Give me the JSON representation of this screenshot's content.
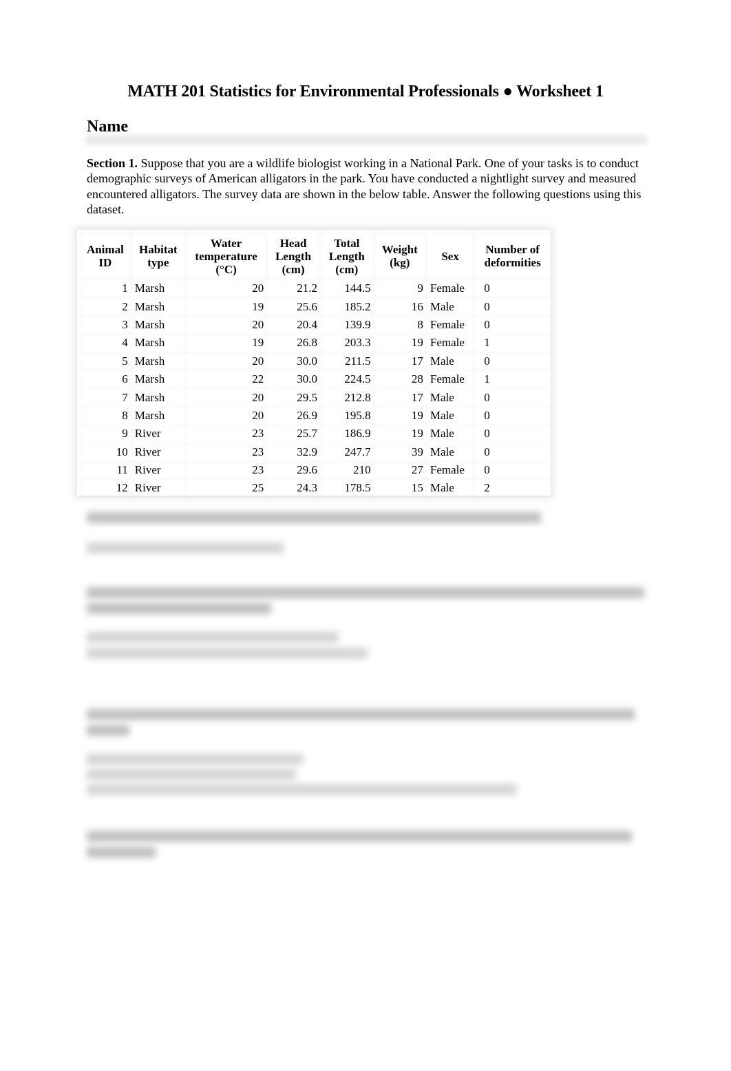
{
  "document": {
    "title": "MATH 201 Statistics for Environmental Professionals ● Worksheet 1",
    "name_label": "Name",
    "section_heading": "Section 1.",
    "section_text": " Suppose that you are a wildlife biologist working in a National Park. One of your tasks is to conduct demographic surveys of American alligators in the park. You have conducted a nightlight survey and measured encountered alligators. The survey data are shown in the below table. Answer the following questions using this dataset."
  },
  "table": {
    "headers": [
      [
        "Animal",
        "ID"
      ],
      [
        "Habitat",
        "type"
      ],
      [
        "Water",
        "temperature",
        "(°C)"
      ],
      [
        "Head",
        "Length",
        "(cm)"
      ],
      [
        "Total",
        "Length",
        "(cm)"
      ],
      [
        "Weight",
        "(kg)"
      ],
      [
        "Sex"
      ],
      [
        "Number of",
        "deformities"
      ]
    ],
    "rows": [
      [
        "1",
        "Marsh",
        "20",
        "21.2",
        "144.5",
        "9",
        "Female",
        "0"
      ],
      [
        "2",
        "Marsh",
        "19",
        "25.6",
        "185.2",
        "16",
        "Male",
        "0"
      ],
      [
        "3",
        "Marsh",
        "20",
        "20.4",
        "139.9",
        "8",
        "Female",
        "0"
      ],
      [
        "4",
        "Marsh",
        "19",
        "26.8",
        "203.3",
        "19",
        "Female",
        "1"
      ],
      [
        "5",
        "Marsh",
        "20",
        "30.0",
        "211.5",
        "17",
        "Male",
        "0"
      ],
      [
        "6",
        "Marsh",
        "22",
        "30.0",
        "224.5",
        "28",
        "Female",
        "1"
      ],
      [
        "7",
        "Marsh",
        "20",
        "29.5",
        "212.8",
        "17",
        "Male",
        "0"
      ],
      [
        "8",
        "Marsh",
        "20",
        "26.9",
        "195.8",
        "19",
        "Male",
        "0"
      ],
      [
        "9",
        "River",
        "23",
        "25.7",
        "186.9",
        "19",
        "Male",
        "0"
      ],
      [
        "10",
        "River",
        "23",
        "32.9",
        "247.7",
        "39",
        "Male",
        "0"
      ],
      [
        "11",
        "River",
        "23",
        "29.6",
        "210",
        "27",
        "Female",
        "0"
      ],
      [
        "12",
        "River",
        "25",
        "24.3",
        "178.5",
        "15",
        "Male",
        "2"
      ]
    ]
  }
}
